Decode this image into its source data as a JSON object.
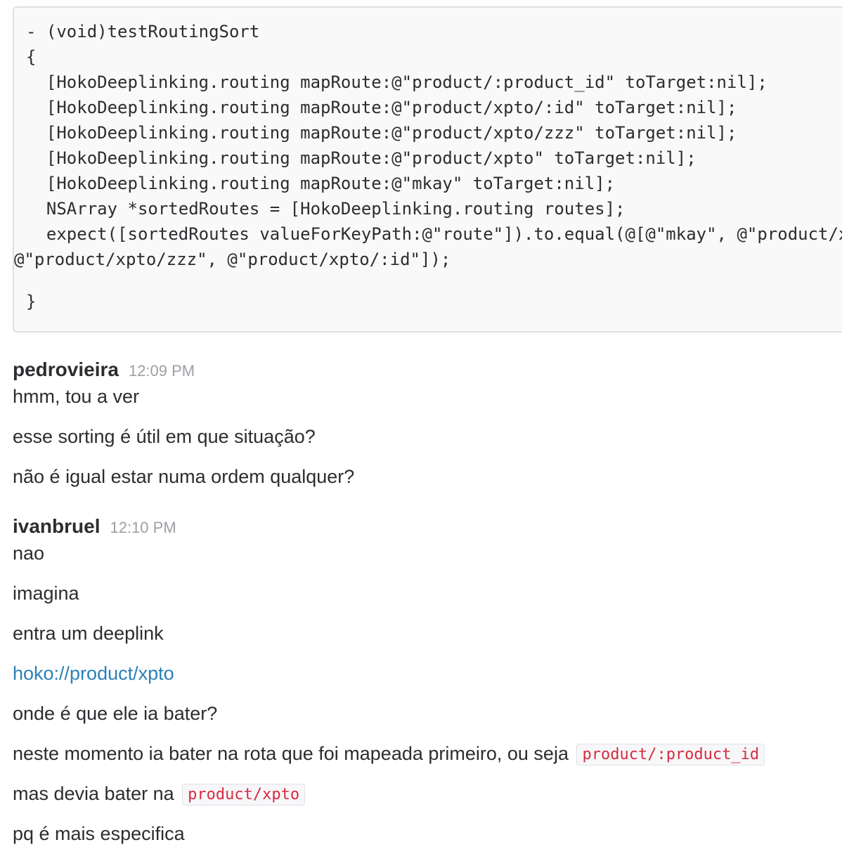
{
  "code_snippet": {
    "lines": [
      "- (void)testRoutingSort",
      "{",
      "  [HokoDeeplinking.routing mapRoute:@\"product/:product_id\" toTarget:nil];",
      "  [HokoDeeplinking.routing mapRoute:@\"product/xpto/:id\" toTarget:nil];",
      "  [HokoDeeplinking.routing mapRoute:@\"product/xpto/zzz\" toTarget:nil];",
      "  [HokoDeeplinking.routing mapRoute:@\"product/xpto\" toTarget:nil];",
      "  [HokoDeeplinking.routing mapRoute:@\"mkay\" toTarget:nil];",
      "  NSArray *sortedRoutes = [HokoDeeplinking.routing routes];",
      "  expect([sortedRoutes valueForKeyPath:@\"route\"]).to.equal(@[@\"mkay\", @\"product/x",
      "@\"product/xpto/zzz\", @\"product/xpto/:id\"]);",
      "",
      "}"
    ]
  },
  "messages": [
    {
      "sender": "pedrovieira",
      "time": "12:09 PM",
      "lines": [
        "hmm, tou a ver",
        "esse sorting é útil em que situação?",
        "não é igual estar numa ordem qualquer?"
      ]
    },
    {
      "sender": "ivanbruel",
      "time": "12:10 PM",
      "lines": [
        "nao",
        "imagina",
        "entra um deeplink",
        "hoko://product/xpto",
        "onde é que ele ia bater?",
        "neste momento ia bater na rota que foi mapeada primeiro, ou seja",
        "mas devia bater na",
        "pq é mais especifica"
      ],
      "inline_code": {
        "first": "product/:product_id",
        "second": "product/xpto"
      }
    }
  ],
  "colors": {
    "link": "#2a80b9",
    "inline_code_text": "#d72b3f",
    "timestamp": "#9e9ea6"
  }
}
